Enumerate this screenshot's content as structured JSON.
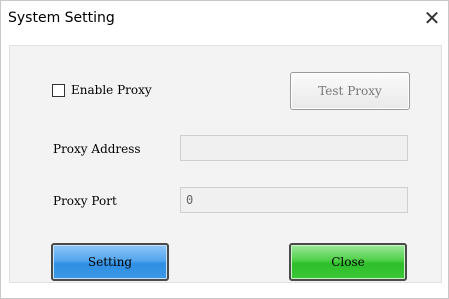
{
  "dialog": {
    "title": "System Setting",
    "close_glyph": "✕"
  },
  "proxy": {
    "enable_label": "Enable Proxy",
    "enabled": false,
    "test_button_label": "Test Proxy",
    "address_label": "Proxy Address",
    "address_value": "",
    "port_label": "Proxy Port",
    "port_value": "0"
  },
  "actions": {
    "setting_label": "Setting",
    "close_label": "Close"
  },
  "colors": {
    "setting_button": "#54a6ee",
    "close_button": "#4fd049",
    "panel_background": "#f3f3f3"
  }
}
